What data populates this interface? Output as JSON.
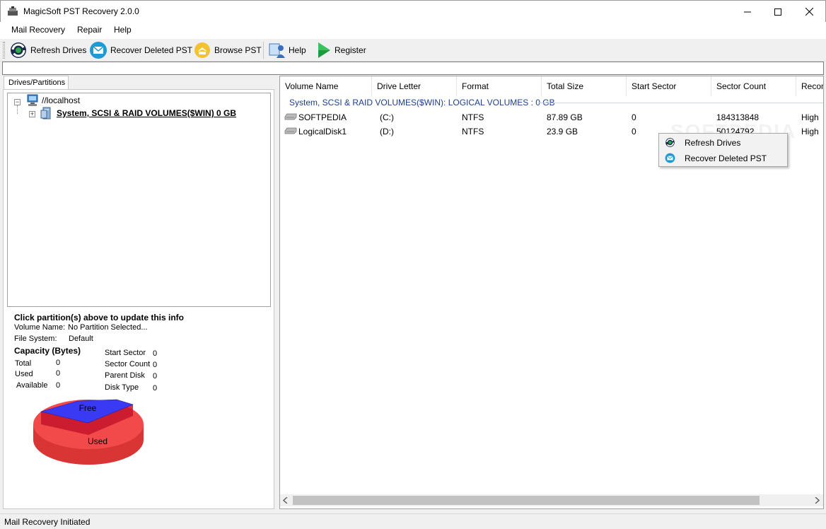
{
  "window": {
    "title": "MagicSoft PST Recovery 2.0.0"
  },
  "menu": [
    "Mail Recovery",
    "Repair",
    "Help"
  ],
  "toolbar": {
    "refresh": "Refresh Drives",
    "recover": "Recover Deleted PST",
    "browse": "Browse PST",
    "help": "Help",
    "register": "Register"
  },
  "address": {
    "value": ""
  },
  "left": {
    "tab": "Drives/Partitions",
    "tree": {
      "root": "//localhost",
      "child": "System, SCSI & RAID VOLUMES($WIN) 0 GB"
    },
    "info": {
      "header": "Click partition(s) above to update this info",
      "volume_label": "Volume Name:",
      "volume_value": "No Partition Selected...",
      "fs_label": "File System:",
      "fs_value": "Default",
      "capacity_header": "Capacity (Bytes)",
      "total_label": "Total",
      "total_value": "0",
      "used_label": "Used",
      "used_value": "0",
      "available_label": "Available",
      "available_value": "0",
      "start_sector_label": "Start Sector",
      "start_sector_value": "0",
      "sector_count_label": "Sector Count",
      "sector_count_value": "0",
      "parent_disk_label": "Parent Disk",
      "parent_disk_value": "0",
      "disk_type_label": "Disk Type",
      "disk_type_value": "0"
    },
    "pie": {
      "free_label": "Free",
      "used_label": "Used",
      "free_color": "#3a3af5",
      "used_color": "#f24a4a"
    }
  },
  "list": {
    "columns": [
      "Volume Name",
      "Drive Letter",
      "Format",
      "Total Size",
      "Start Sector",
      "Sector Count",
      "Recon"
    ],
    "group": "System, SCSI & RAID VOLUMES($WIN): LOGICAL VOLUMES : 0 GB",
    "rows": [
      {
        "name": "SOFTPEDIA",
        "drive": "(C:)",
        "format": "NTFS",
        "size": "87.89 GB",
        "start": "0",
        "count": "184313848",
        "recon": "High"
      },
      {
        "name": "LogicalDisk1",
        "drive": "(D:)",
        "format": "NTFS",
        "size": "23.9 GB",
        "start": "0",
        "count": "50124792",
        "recon": "High"
      }
    ]
  },
  "context_menu": [
    "Refresh Drives",
    "Recover Deleted PST"
  ],
  "watermark": "SOFTPEDIA",
  "status": "Mail Recovery Initiated"
}
